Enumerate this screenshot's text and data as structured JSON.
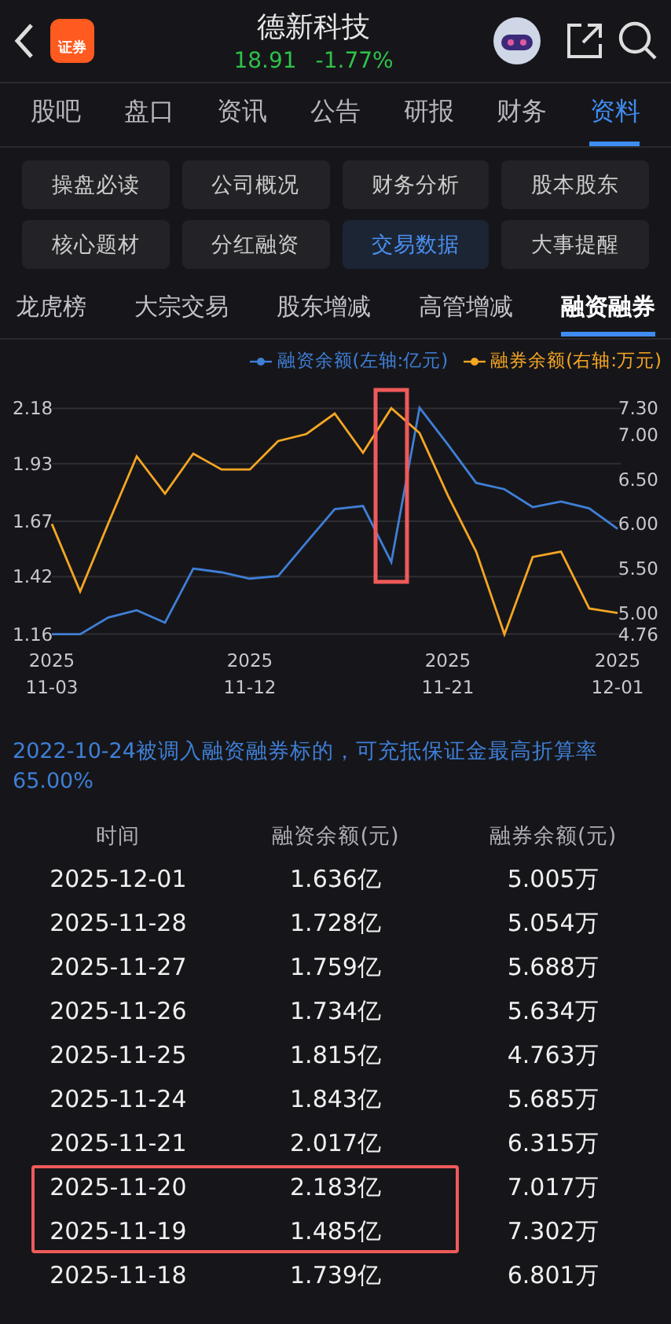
{
  "header": {
    "app_badge": "证券",
    "title": "德新科技",
    "price": "18.91",
    "change": "-1.77%"
  },
  "tabs": [
    {
      "label": "股吧",
      "selected": false
    },
    {
      "label": "盘口",
      "selected": false
    },
    {
      "label": "资讯",
      "selected": false
    },
    {
      "label": "公告",
      "selected": false
    },
    {
      "label": "研报",
      "selected": false
    },
    {
      "label": "财务",
      "selected": false
    },
    {
      "label": "资料",
      "selected": true
    }
  ],
  "sections": [
    {
      "label": "操盘必读",
      "selected": false
    },
    {
      "label": "公司概况",
      "selected": false
    },
    {
      "label": "财务分析",
      "selected": false
    },
    {
      "label": "股本股东",
      "selected": false
    },
    {
      "label": "核心题材",
      "selected": false
    },
    {
      "label": "分红融资",
      "selected": false
    },
    {
      "label": "交易数据",
      "selected": true
    },
    {
      "label": "大事提醒",
      "selected": false
    }
  ],
  "subtabs": [
    {
      "label": "龙虎榜",
      "selected": false
    },
    {
      "label": "大宗交易",
      "selected": false
    },
    {
      "label": "股东增减",
      "selected": false
    },
    {
      "label": "高管增减",
      "selected": false
    },
    {
      "label": "融资融券",
      "selected": true
    }
  ],
  "chart": {
    "chart_data": {
      "type": "line",
      "categories": [
        "2025 11-03",
        null,
        null,
        null,
        null,
        null,
        null,
        "2025 11-12",
        null,
        null,
        null,
        null,
        null,
        null,
        "2025 11-21",
        null,
        null,
        null,
        null,
        null,
        "2025 12-01"
      ],
      "series": [
        {
          "name": "融资余额(左轴:亿元)",
          "color": "#3f7fd6",
          "values": [
            1.16,
            1.16,
            1.235,
            1.268,
            1.212,
            1.456,
            1.439,
            1.411,
            1.423,
            1.575,
            1.725,
            1.739,
            1.485,
            2.183,
            2.017,
            1.843,
            1.815,
            1.734,
            1.759,
            1.728,
            1.636
          ]
        },
        {
          "name": "融券余额(右轴:万元)",
          "color": "#f5a623",
          "axis": "y2",
          "values": [
            6.0,
            5.24,
            6.01,
            6.76,
            6.34,
            6.79,
            6.61,
            6.61,
            6.93,
            7.01,
            7.24,
            6.8,
            7.3,
            7.02,
            6.32,
            5.69,
            4.76,
            5.63,
            5.69,
            5.05,
            5.0
          ]
        }
      ],
      "ylim": [
        1.155,
        2.185
      ],
      "y2lim": [
        4.75,
        7.31
      ],
      "yticks": [
        {
          "value": 2.18,
          "label": "2.18"
        },
        {
          "value": 1.93,
          "label": "1.93"
        },
        {
          "value": 1.67,
          "label": "1.67"
        },
        {
          "value": 1.42,
          "label": "1.42"
        },
        {
          "value": 1.16,
          "label": "1.16"
        }
      ],
      "y2ticks": [
        {
          "value": 7.3,
          "label": "7.30"
        },
        {
          "value": 7.0,
          "label": "7.00"
        },
        {
          "value": 6.5,
          "label": "6.50"
        },
        {
          "value": 6.0,
          "label": "6.00"
        },
        {
          "value": 5.5,
          "label": "5.50"
        },
        {
          "value": 5.0,
          "label": "5.00"
        },
        {
          "value": 4.76,
          "label": "4.76"
        }
      ],
      "grid": true
    },
    "highlight_box": true
  },
  "note": "2022-10-24被调入融资融券标的，可充抵保证金最高折算率65.00%",
  "table": {
    "columns": [
      "时间",
      "融资余额(元)",
      "融券余额(元)"
    ],
    "rows": [
      {
        "date": "2025-12-01",
        "financing": "1.636亿",
        "short": "5.005万",
        "highlighted": false
      },
      {
        "date": "2025-11-28",
        "financing": "1.728亿",
        "short": "5.054万",
        "highlighted": false
      },
      {
        "date": "2025-11-27",
        "financing": "1.759亿",
        "short": "5.688万",
        "highlighted": false
      },
      {
        "date": "2025-11-26",
        "financing": "1.734亿",
        "short": "5.634万",
        "highlighted": false
      },
      {
        "date": "2025-11-25",
        "financing": "1.815亿",
        "short": "4.763万",
        "highlighted": false
      },
      {
        "date": "2025-11-24",
        "financing": "1.843亿",
        "short": "5.685万",
        "highlighted": false
      },
      {
        "date": "2025-11-21",
        "financing": "2.017亿",
        "short": "6.315万",
        "highlighted": false
      },
      {
        "date": "2025-11-20",
        "financing": "2.183亿",
        "short": "7.017万",
        "highlighted": true
      },
      {
        "date": "2025-11-19",
        "financing": "1.485亿",
        "short": "7.302万",
        "highlighted": true
      },
      {
        "date": "2025-11-18",
        "financing": "1.739亿",
        "short": "6.801万",
        "highlighted": false
      }
    ]
  }
}
